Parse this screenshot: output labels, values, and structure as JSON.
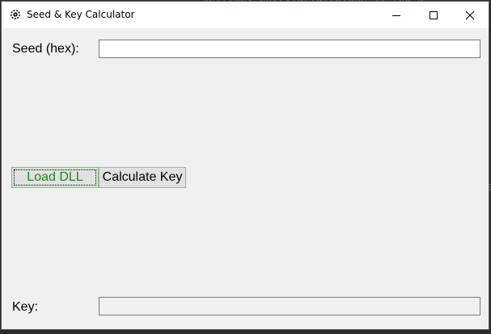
{
  "window": {
    "title": "Seed & Key Calculator",
    "icon": "gear-icon"
  },
  "titlebar_controls": [
    "minimize-icon",
    "maximize-icon",
    "close-icon"
  ],
  "seed": {
    "label": "Seed (hex):",
    "value": ""
  },
  "buttons": {
    "load_dll": "Load DLL",
    "calculate_key": "Calculate Key"
  },
  "key": {
    "label": "Key:",
    "value": ""
  },
  "colors": {
    "window_bg": "#f0f0f0",
    "titlebar_bg": "#ffffff",
    "focused_button_text": "#1a8a1a"
  }
}
